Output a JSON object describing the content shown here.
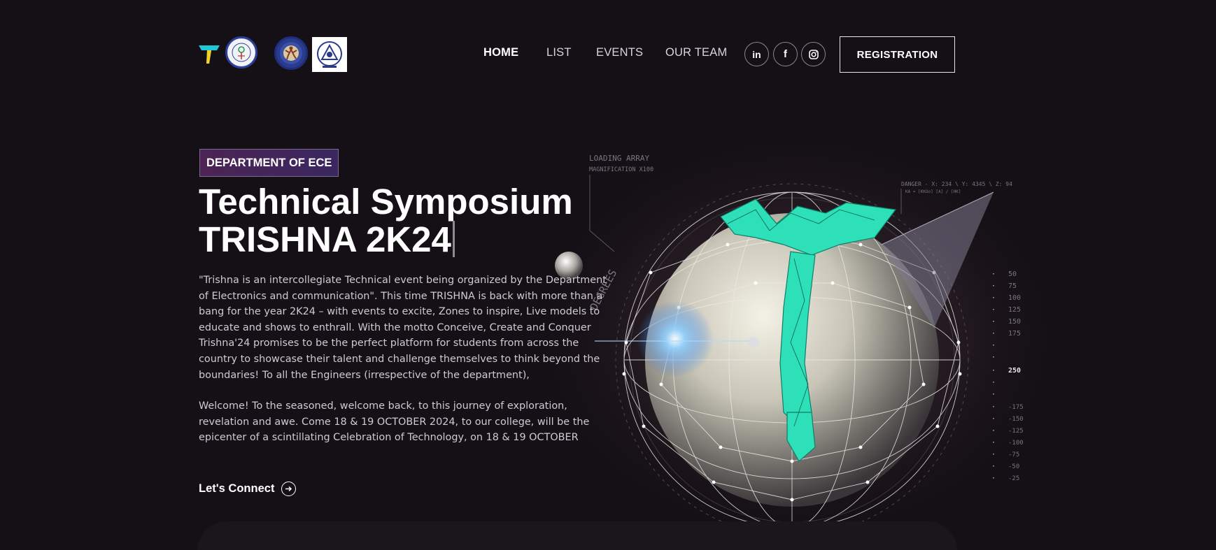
{
  "header": {
    "logos": [
      {
        "name": "trishna-t-logo"
      },
      {
        "name": "college-emblem-logo"
      },
      {
        "name": "dancer-emblem-logo"
      },
      {
        "name": "association-emblem-logo"
      }
    ],
    "nav": [
      {
        "label": "HOME",
        "active": true
      },
      {
        "label": "LIST",
        "active": false
      },
      {
        "label": "EVENTS",
        "active": false
      },
      {
        "label": "OUR TEAM",
        "active": false
      }
    ],
    "social": [
      {
        "icon": "linkedin-icon",
        "glyph": "in"
      },
      {
        "icon": "facebook-icon",
        "glyph": "f"
      },
      {
        "icon": "instagram-icon",
        "glyph": ""
      }
    ],
    "registration_label": "REGISTRATION"
  },
  "hero": {
    "badge": "DEPARTMENT OF ECE",
    "title_line1": "Technical Symposium",
    "title_line2": "TRISHNA 2K24",
    "paragraph1": "\"Trishna is an intercollegiate Technical event being organized by the Department of Electronics and communication\". This time TRISHNA is back with more than a bang for the year 2K24 – with events to excite, Zones to inspire, Live models to educate and shows to enthrall. With the motto Conceive, Create and Conquer Trishna'24 promises to be the perfect platform for students from across the country to showcase their talent and challenge themselves to think beyond the boundaries! To all the Engineers (irrespective of the department),",
    "paragraph2": "Welcome! To the seasoned, welcome back, to this journey of exploration, revelation and awe. Come 18 & 19 OCTOBER 2024, to our college, will be the epicenter of a scintillating Celebration of Technology, on 18 & 19 OCTOBER",
    "cta_label": "Let's Connect"
  },
  "hud": {
    "loading_label": "LOADING ARRAY",
    "magnification_label": "MAGNIFICATION X100",
    "danger_label": "DANGER - X: 234 \\ Y: 4345 \\ Z: 94",
    "danger_sub": "KA = [KKOo] [A] / [HK]",
    "arc_label": "DEGREES",
    "scale_top": [
      "50",
      "75",
      "100",
      "125",
      "150",
      "175"
    ],
    "scale_mid": "250",
    "scale_bottom": [
      "-175",
      "-150",
      "-125",
      "-100",
      "-75",
      "-50",
      "-25"
    ]
  },
  "colors": {
    "background": "#141015",
    "badge_gradient_start": "#4d2455",
    "badge_gradient_end": "#3a2760",
    "logo_teal": "#2ee0b8"
  }
}
